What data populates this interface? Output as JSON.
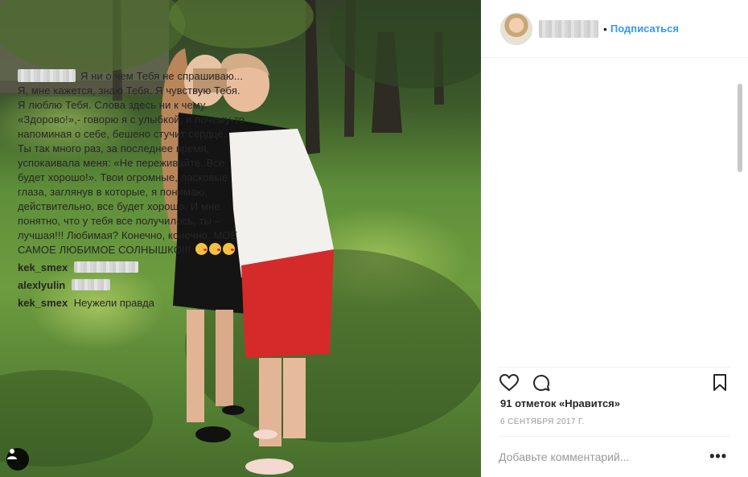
{
  "post": {
    "photo_alt": "Photo",
    "header": {
      "dot": "•",
      "follow_label": "Подписаться"
    },
    "caption": "Я ни о чем Тебя не спрашиваю... Я, мне кажется, знаю Тебя. Я чувствую Тебя. Я люблю Тебя. Слова здесь ни к чему. «Здорово!»,- говорю я с улыбкой, и почему-то напоминая о себе, бешено стучит сердце.\nТы так много раз, за последнее время, успокаивала меня: «Не переживайте. Все будет хорошо!». Твои огромные, ласковые глаза, заглянув в которые, я понимаю, действительно, все будет хорошо. И мне понятно, что у тебя все получилось, ты – лучшая!!! Любимая? Конечно, конечно, МОЁ САМОЕ ЛЮБИМОЕ СОЛНЫШКО!!!",
    "comments": [
      {
        "user": "kek_smex",
        "text": ""
      },
      {
        "user": "alexlyulin",
        "text": ""
      },
      {
        "user": "kek_smex",
        "text": "Неужели правда"
      }
    ],
    "likes": "91 отметок «Нравится»",
    "date": "6 сентября 2017 г.",
    "add_comment_placeholder": "Добавьте комментарий...",
    "more_label": "•••",
    "icons": [
      "heart-icon",
      "comment-icon",
      "bookmark-icon",
      "user-tag-icon"
    ]
  }
}
